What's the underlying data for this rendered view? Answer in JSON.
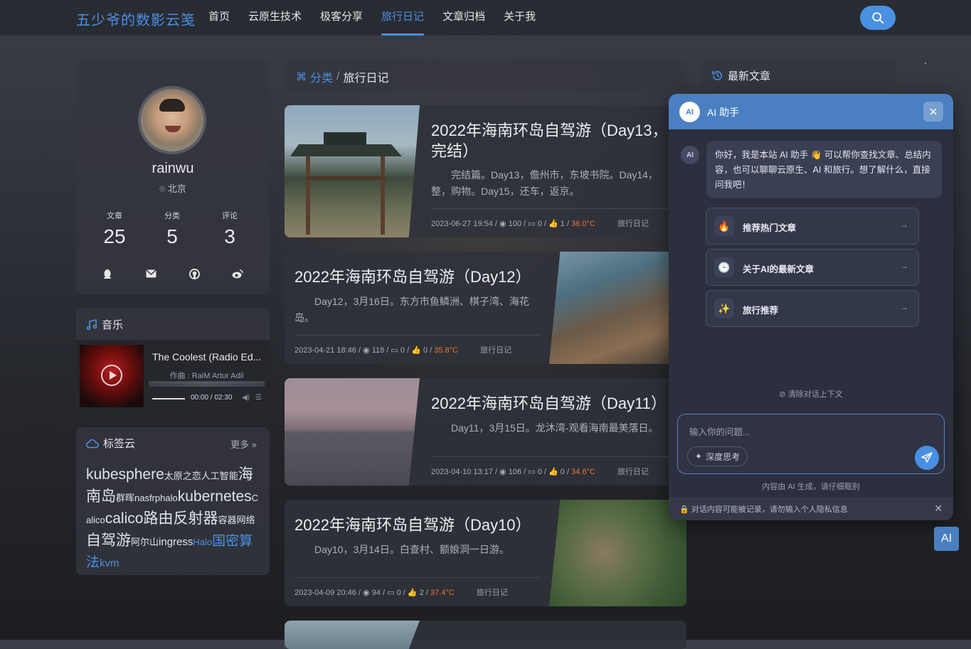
{
  "site": {
    "title": "五少爷的数影云笺"
  },
  "nav": {
    "items": [
      "首页",
      "云原生技术",
      "极客分享",
      "旅行日记",
      "文章归档",
      "关于我"
    ],
    "active": "旅行日记"
  },
  "profile": {
    "username": "rainwu",
    "location": "北京",
    "stats": [
      {
        "label": "文章",
        "value": "25"
      },
      {
        "label": "分类",
        "value": "5"
      },
      {
        "label": "评论",
        "value": "3"
      }
    ],
    "social_icons": [
      "qq-icon",
      "mail-icon",
      "github-icon",
      "weibo-icon"
    ]
  },
  "music": {
    "title": "音乐",
    "song": "The Coolest (Radio Ed...",
    "artist": "作曲 : RaiM Artur Adil",
    "time": "00:00 / 02:30",
    "progress": 0.0
  },
  "tags": {
    "title": "标签云",
    "more": "更多",
    "items": [
      {
        "text": "kubesphere",
        "size": "big"
      },
      {
        "text": "太原之恋",
        "size": "small"
      },
      {
        "text": "人工智能",
        "size": "small"
      },
      {
        "text": "海南岛",
        "size": "big"
      },
      {
        "text": "群晖",
        "size": "small"
      },
      {
        "text": "nas",
        "size": "small"
      },
      {
        "text": "frp",
        "size": "small"
      },
      {
        "text": "halo",
        "size": "small"
      },
      {
        "text": "kubernetes",
        "size": "big"
      },
      {
        "text": "Calico",
        "size": "small"
      },
      {
        "text": "calico",
        "size": "big"
      },
      {
        "text": "路由反射器",
        "size": "big"
      },
      {
        "text": "容器网络",
        "size": "small"
      },
      {
        "text": "自驾游",
        "size": "big"
      },
      {
        "text": "阿尔山",
        "size": "small"
      },
      {
        "text": "ingress",
        "size": "mid"
      },
      {
        "text": "Halo",
        "size": "blue-small"
      },
      {
        "text": "国密算法",
        "size": "blue-big"
      },
      {
        "text": "kvm",
        "size": "blue-mid"
      }
    ]
  },
  "breadcrumb": {
    "category": "分类",
    "separator": "/",
    "current": "旅行日记"
  },
  "latest": {
    "title": "最新文章"
  },
  "posts": [
    {
      "title": "2022年海南环岛自驾游（Day13，完结）",
      "excerpt": "完结篇。Day13，儋州市，东坡书院。Day14，整，购物。Day15，还车，返京。",
      "date": "2023-06-27 19:54",
      "views": "100",
      "comments": "0",
      "likes": "1",
      "temp": "36.0°C",
      "category": "旅行日记"
    },
    {
      "title": "2022年海南环岛自驾游（Day12）",
      "excerpt": "Day12，3月16日。东方市鱼鳞洲、棋子湾、海花岛。",
      "date": "2023-04-21 18:46",
      "views": "118",
      "comments": "0",
      "likes": "0",
      "temp": "35.8°C",
      "category": "旅行日记"
    },
    {
      "title": "2022年海南环岛自驾游（Day11）",
      "excerpt": "Day11，3月15日。龙沐湾-观看海南最美落日。",
      "date": "2023-04-10 13:17",
      "views": "106",
      "comments": "0",
      "likes": "0",
      "temp": "34.6°C",
      "category": "旅行日记"
    },
    {
      "title": "2022年海南环岛自驾游（Day10）",
      "excerpt": "Day10，3月14日。白查村、额娘洞一日游。",
      "date": "2023-04-09 20:46",
      "views": "94",
      "comments": "0",
      "likes": "2",
      "temp": "37.4°C",
      "category": "旅行日记"
    }
  ],
  "ai": {
    "logo": "AI",
    "title": "AI 助手",
    "greeting": "你好，我是本站 AI 助手 👋 可以帮你查找文章、总结内容，也可以聊聊云原生、AI 和旅行。想了解什么，直接问我吧！",
    "suggestions": [
      {
        "icon": "🔥",
        "label": "推荐热门文章"
      },
      {
        "icon": "🕒",
        "label": "关于AI的最新文章"
      },
      {
        "icon": "✨",
        "label": "旅行推荐"
      }
    ],
    "clear": "清除对话上下文",
    "input_placeholder": "输入你的问题...",
    "deep_think": "深度思考",
    "disclaimer": "内容由 AI 生成，请仔细甄别",
    "privacy": "对话内容可能被记录，请勿输入个人隐私信息",
    "fab": "AI"
  },
  "colors": {
    "accent": "#4a90e2",
    "ai_header": "#4a7fc1",
    "temp": "#e8753a"
  }
}
